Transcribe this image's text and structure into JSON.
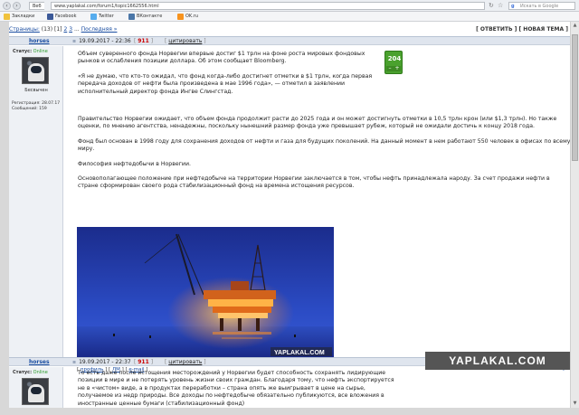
{
  "browser": {
    "site_label": "Веб",
    "url": "www.yaplakal.com/forum1/topic1662556.html",
    "search_placeholder": "Искать в Google",
    "search_icon_letter": "g"
  },
  "bookmarks": [
    {
      "label": "Закладки",
      "color": "#f0c23d"
    },
    {
      "label": "Facebook",
      "color": "#3b5998"
    },
    {
      "label": "Twitter",
      "color": "#55acee"
    },
    {
      "label": "ВКонтакте",
      "color": "#4a76a8"
    },
    {
      "label": "OK.ru",
      "color": "#f7931e"
    }
  ],
  "pager": {
    "label": "Страницы:",
    "count": "(13)",
    "current": "[1]",
    "p2": "2",
    "p3": "3",
    "dots": "...",
    "last": "Последняя »",
    "actions": "[ ОТВЕТИТЬ ] [ НОВАЯ ТЕМА ]"
  },
  "posts": [
    {
      "username": "horses",
      "date": "19.09.2017 - 22:36",
      "post_id": "911",
      "quote_label": "цитировать",
      "status_label": "Статус:",
      "status_value": "Online",
      "rank": "Бесвычен",
      "reg": "Регистрация: 28.07.17",
      "messages": "Сообщений: 159",
      "rating": "204",
      "paragraphs": [
        "Объем суверенного фонда Норвегии впервые достиг $1 трлн на фоне роста мировых фондовых рынков и ослабления позиции доллара. Об этом сообщает Bloomberg.",
        "«Я не думаю, что кто-то ожидал, что фонд когда-либо достигнет отметки в $1 трлн, когда первая передача доходов от нефти была произведена в мае 1996 года», — отметил в заявлении исполнительный директор фонда Ингве Слингстад.",
        "Правительство Норвегии ожидает, что объем фонда продолжит расти до 2025 года и он может достигнуть отметки в 10,5 трлн крон (или $1,3 трлн). Но также оценки, по мнению агентства, ненадежны, поскольку нынешний размер фонда уже превышает рубеж, который не ожидали достичь к концу 2018 года.",
        "Фонд был основан в 1998 году для сохранения доходов от нефти и газа для будущих поколений. На данный момент в нем работают 550 человек в офисах по всему миру.",
        "Философия нефтедобычи в Норвегии.",
        "Основополагающее положение при нефтедобыче на территории Норвегии заключается в том, чтобы нефть принадлежала народу. За счет продажи нефти в стране сформирован своего рода стабилизационный фонд на времена истощения ресурсов."
      ],
      "photo_watermark": "YAPLAKAL.COM",
      "footer": [
        "профиль",
        "ЛМ",
        "e-mail"
      ]
    },
    {
      "username": "horses",
      "date": "19.09.2017 - 22:37",
      "post_id": "911",
      "quote_label": "цитировать",
      "status_label": "Статус:",
      "status_value": "Online",
      "paragraphs": [
        "То есть даже после истощения месторождений у Норвегии будет способность сохранять лидирующие позиции в мире и не потерять уровень жизни своих граждан. Благодаря тому, что нефть экспортируется не в «чистом» виде, а в продуктах переработки – страна опять же выигрывает в цене на сырье, получаемое из недр природы. Все доходы по нефтедобыче обязательно публикуются, все вложения в иностранные ценные бумаги (стабилизационный фонд)"
      ]
    }
  ],
  "watermark": "YAPLAKAL.COM",
  "up_arrow": "↑"
}
